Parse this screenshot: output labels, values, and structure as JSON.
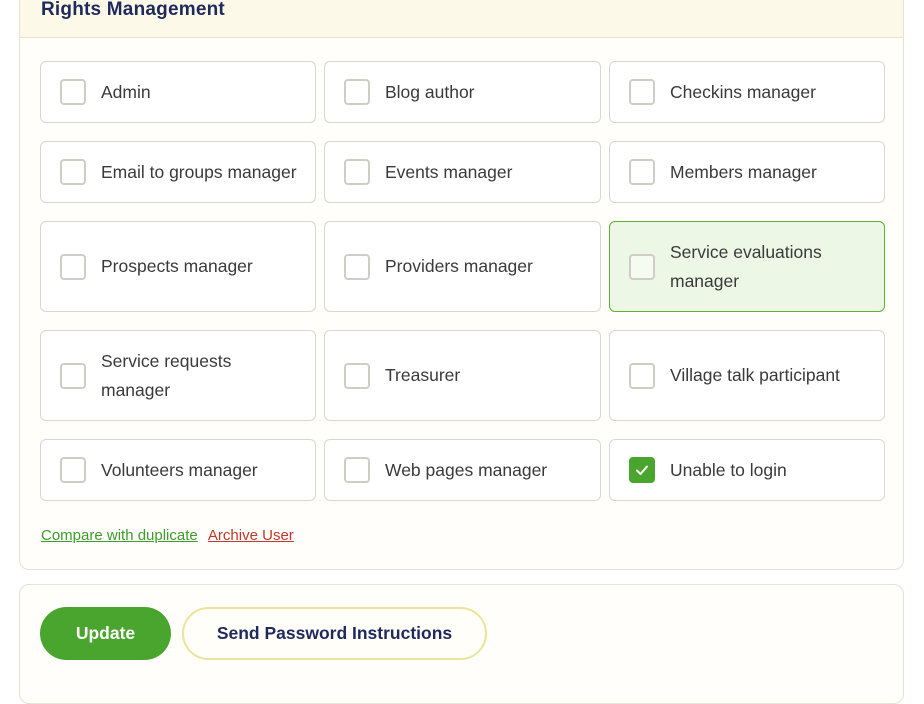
{
  "section": {
    "title": "Rights Management"
  },
  "rights": [
    {
      "label": "Admin",
      "checked": false
    },
    {
      "label": "Blog author",
      "checked": false
    },
    {
      "label": "Checkins manager",
      "checked": false
    },
    {
      "label": "Email to groups manager",
      "checked": false
    },
    {
      "label": "Events manager",
      "checked": false
    },
    {
      "label": "Members manager",
      "checked": false
    },
    {
      "label": "Prospects manager",
      "checked": false
    },
    {
      "label": "Providers manager",
      "checked": false
    },
    {
      "label": "Service evaluations manager",
      "checked": false,
      "highlighted": true
    },
    {
      "label": "Service requests manager",
      "checked": false
    },
    {
      "label": "Treasurer",
      "checked": false
    },
    {
      "label": "Village talk participant",
      "checked": false
    },
    {
      "label": "Volunteers manager",
      "checked": false
    },
    {
      "label": "Web pages manager",
      "checked": false
    },
    {
      "label": "Unable to login",
      "checked": true
    }
  ],
  "links": {
    "compare": "Compare with duplicate",
    "archive": "Archive User"
  },
  "actions": {
    "update_label": "Update",
    "send_password_label": "Send Password Instructions"
  },
  "colors": {
    "accent_green": "#4aa52e",
    "title_navy": "#1f2a5c",
    "archive_red": "#c0382b"
  }
}
